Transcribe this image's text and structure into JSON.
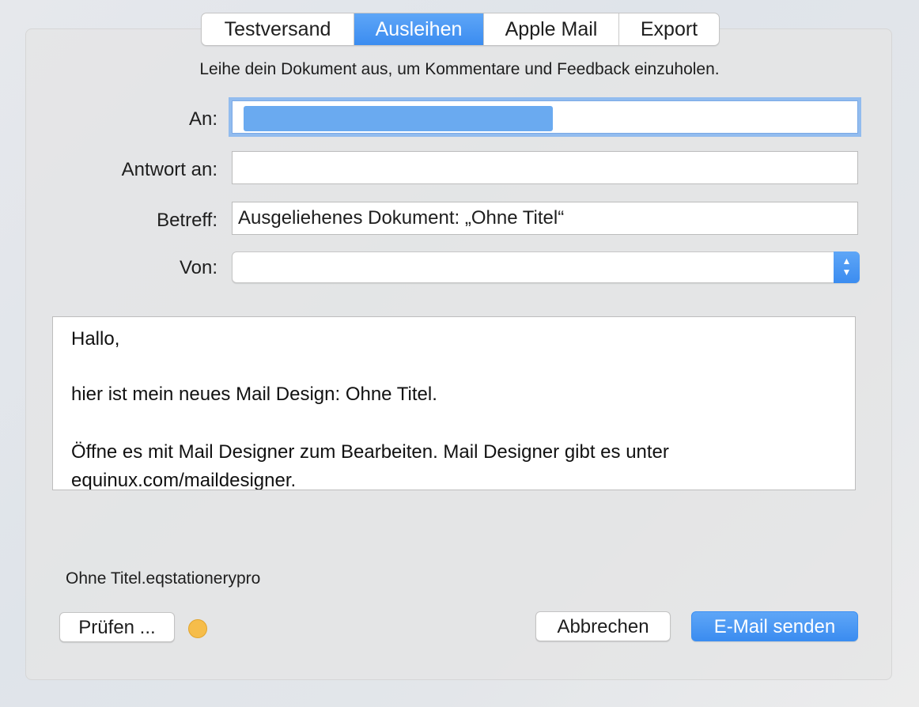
{
  "tabs": [
    {
      "label": "Testversand",
      "active": false
    },
    {
      "label": "Ausleihen",
      "active": true
    },
    {
      "label": "Apple Mail",
      "active": false
    },
    {
      "label": "Export",
      "active": false
    }
  ],
  "intro_text": "Leihe dein Dokument aus, um Kommentare und Feedback einzuholen.",
  "form": {
    "to_label": "An:",
    "to_value": "",
    "reply_label": "Antwort an:",
    "reply_value": "",
    "subject_label": "Betreff:",
    "subject_value": "Ausgeliehenes Dokument: „Ohne Titel“",
    "from_label": "Von:",
    "from_value": ""
  },
  "message": {
    "lines": [
      "Hallo,",
      "hier ist mein neues Mail Design: Ohne Titel.",
      "Öffne es mit Mail Designer zum Bearbeiten. Mail Designer gibt es unter",
      "equinux.com/maildesigner."
    ]
  },
  "filename": "Ohne Titel.eqstationerypro",
  "buttons": {
    "check_label": "Prüfen ...",
    "cancel_label": "Abbrechen",
    "send_label": "E-Mail senden"
  },
  "icons": {
    "popup": "up-down-chevron-icon",
    "status": "status-dot-icon"
  },
  "colors": {
    "accent": "#3b8cf0",
    "accent_light": "#5ea6f7",
    "selection": "#6aaaf0",
    "focus_ring": "#92bcef",
    "status_dot": "#f6bd4a"
  }
}
